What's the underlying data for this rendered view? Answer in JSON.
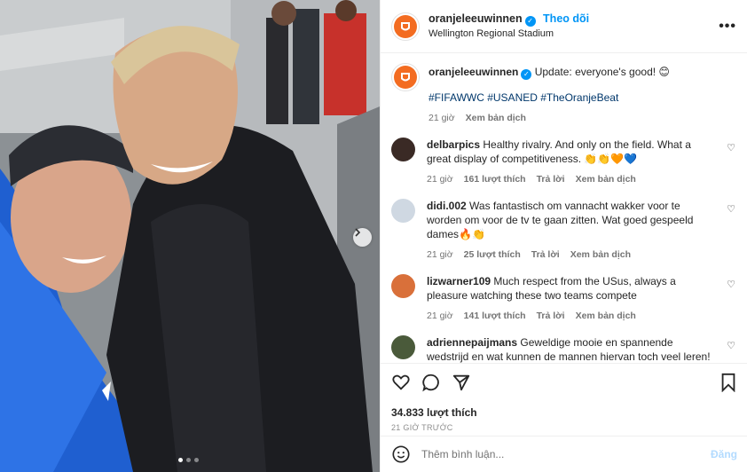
{
  "post": {
    "username": "oranjeleeuwinnen",
    "follow_label": "Theo dõi",
    "location": "Wellington Regional Stadium",
    "more_label": "•••",
    "caption_text": "Update: everyone's good! 😊",
    "hashtags": "#FIFAWWC #USANED #TheOranjeBeat",
    "caption_time": "21 giờ",
    "caption_translate": "Xem bản dịch",
    "likes": "34.833 lượt thích",
    "ago": "21 GIỜ TRƯỚC",
    "comment_placeholder": "Thêm bình luận...",
    "post_label": "Đăng"
  },
  "comments": [
    {
      "user": "delbarpics",
      "text": "Healthy rivalry. And only on the field. What a great display of competitiveness. 👏👏🧡💙",
      "time": "21 giờ",
      "likes": "161 lượt thích",
      "reply": "Trả lời",
      "translate": "Xem bản dịch",
      "avatar_color": "#3a2a25"
    },
    {
      "user": "didi.002",
      "text": "Was fantastisch om vannacht wakker voor te worden om voor de tv te gaan zitten. Wat goed gespeeld dames🔥👏",
      "time": "21 giờ",
      "likes": "25 lượt thích",
      "reply": "Trả lời",
      "translate": "Xem bản dịch",
      "avatar_color": "#cfd8e2"
    },
    {
      "user": "lizwarner109",
      "text": "Much respect from the USus, always a pleasure watching these two teams compete",
      "time": "21 giờ",
      "likes": "141 lượt thích",
      "reply": "Trả lời",
      "translate": "Xem bản dịch",
      "avatar_color": "#d9703a"
    },
    {
      "user": "adriennepaijmans",
      "text": "Geweldige mooie en spannende wedstrijd en wat kunnen de mannen hiervan toch veel leren! Geen achterlijke toneelstukjes op het veld en niet constant discussies",
      "time": "",
      "likes": "",
      "reply": "",
      "translate": "",
      "avatar_color": "#4a5a3a"
    }
  ],
  "colors": {
    "brand_orange": "#f36c21",
    "verified_blue": "#0095f6",
    "link_blue": "#00376b"
  }
}
